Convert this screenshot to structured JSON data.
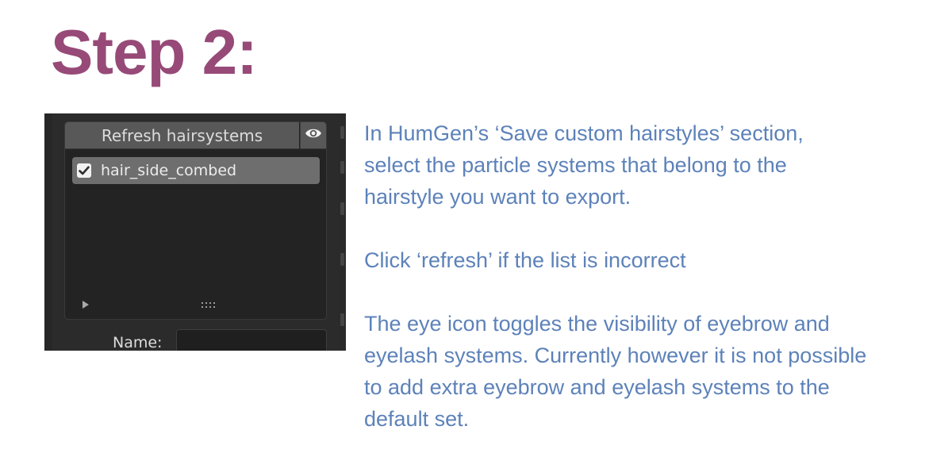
{
  "heading": "Step 2:",
  "screenshot": {
    "refresh_button_label": "Refresh hairsystems",
    "eye_button": {
      "icon": "eye-icon",
      "icon_color": "#f2f2f2"
    },
    "list_items": [
      {
        "label": "hair_side_combed",
        "checked": true
      }
    ],
    "expand_icon": "play-triangle-icon",
    "resize_icon": "grip-dots-icon",
    "name_label": "Name:",
    "name_value": ""
  },
  "instructions": {
    "paragraph_1": [
      "In HumGen’s ‘Save custom hairstyles’ section,",
      "select the particle systems that belong to the",
      "hairstyle you want to export."
    ],
    "paragraph_2": [
      "Click ‘refresh’ if the list is incorrect"
    ],
    "paragraph_3": [
      "The eye icon toggles the visibility of eyebrow and",
      "eyelash systems. Currently however it is not possible",
      "to add extra eyebrow and eyelash systems to the",
      "default set."
    ]
  },
  "colors": {
    "heading": "#974a77",
    "instructions_text": "#5d82b9",
    "panel_background": "#2b2b2b",
    "button_background": "#585858",
    "selected_item": "#6e6e6e"
  }
}
